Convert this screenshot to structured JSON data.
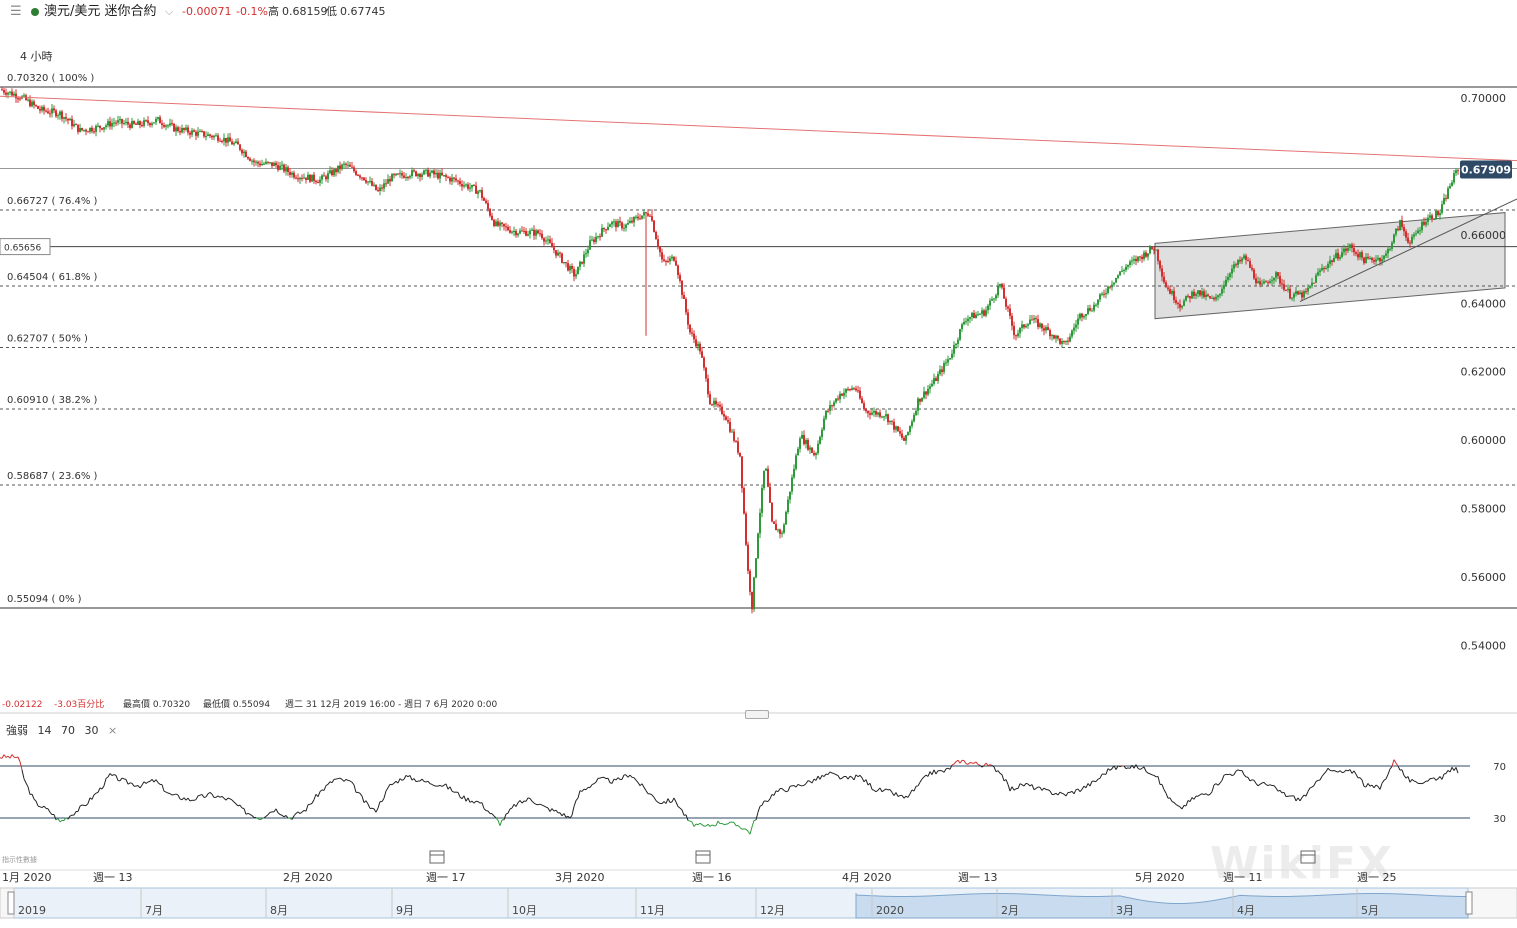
{
  "header": {
    "menu_icon": "hamburger-menu-icon",
    "status_color": "#2e7d32",
    "instrument": "澳元/美元 迷你合約",
    "change": "-0.00071",
    "change_pct": "-0.1%",
    "high_label": "高",
    "high": "0.68159",
    "low_label": "低",
    "low": "0.67745"
  },
  "timeframe": "4 小時",
  "stats": {
    "change": "-0.02122",
    "change_pct": "-3.03百分比",
    "highest": "最高價 0.70320",
    "lowest": "最低價 0.55094",
    "range": "週二 31 12月 2019 16:00 - 週日 7 6月 2020 0:00"
  },
  "rsi_legend": {
    "name": "強弱",
    "period": "14",
    "upper": "70",
    "lower": "30",
    "close": "×"
  },
  "indicator_data_label": "指示性數據",
  "watermark": "WikiFX",
  "colors": {
    "up": "#2e9a3a",
    "down": "#d32f2f",
    "trendline": "#e57373",
    "current_price_bg": "#2f4a66",
    "channel_fill": "#d9d9d9",
    "navigator_fill": "#c9dcef"
  },
  "chart_data": [
    {
      "type": "candlestick",
      "y_range": [
        0.535,
        0.704
      ],
      "y_ticks": [
        "0.70000",
        "0.66000",
        "0.64000",
        "0.62000",
        "0.60000",
        "0.58000",
        "0.56000",
        "0.54000"
      ],
      "current_price": "0.67909",
      "cursor_price": "0.65656",
      "fib_levels": [
        {
          "label": "0.70320 ( 100% )",
          "value": 0.7032
        },
        {
          "label": "0.66727 ( 76.4% )",
          "value": 0.66727
        },
        {
          "label": "0.64504 ( 61.8% )",
          "value": 0.64504
        },
        {
          "label": "0.62707 ( 50% )",
          "value": 0.62707
        },
        {
          "label": "0.60910 ( 38.2% )",
          "value": 0.6091
        },
        {
          "label": "0.58687 ( 23.6% )",
          "value": 0.58687
        },
        {
          "label": "0.55094 ( 0% )",
          "value": 0.55094
        }
      ],
      "series_close": [
        [
          0,
          0.7025
        ],
        [
          20,
          0.7005
        ],
        [
          40,
          0.6965
        ],
        [
          60,
          0.6955
        ],
        [
          80,
          0.6905
        ],
        [
          100,
          0.6915
        ],
        [
          115,
          0.693
        ],
        [
          135,
          0.692
        ],
        [
          158,
          0.6935
        ],
        [
          175,
          0.691
        ],
        [
          200,
          0.6895
        ],
        [
          220,
          0.6885
        ],
        [
          238,
          0.686
        ],
        [
          255,
          0.681
        ],
        [
          275,
          0.6805
        ],
        [
          295,
          0.6775
        ],
        [
          320,
          0.676
        ],
        [
          345,
          0.6805
        ],
        [
          365,
          0.6765
        ],
        [
          378,
          0.6725
        ],
        [
          390,
          0.6765
        ],
        [
          410,
          0.678
        ],
        [
          430,
          0.678
        ],
        [
          455,
          0.676
        ],
        [
          480,
          0.6725
        ],
        [
          495,
          0.663
        ],
        [
          515,
          0.661
        ],
        [
          540,
          0.6605
        ],
        [
          560,
          0.6535
        ],
        [
          575,
          0.648
        ],
        [
          590,
          0.6575
        ],
        [
          610,
          0.6635
        ],
        [
          625,
          0.6625
        ],
        [
          640,
          0.6655
        ],
        [
          650,
          0.6665
        ],
        [
          655,
          0.6605
        ],
        [
          663,
          0.6515
        ],
        [
          675,
          0.6535
        ],
        [
          690,
          0.6315
        ],
        [
          700,
          0.6265
        ],
        [
          710,
          0.6115
        ],
        [
          725,
          0.6075
        ],
        [
          740,
          0.5955
        ],
        [
          748,
          0.5615
        ],
        [
          752,
          0.5515
        ],
        [
          758,
          0.5735
        ],
        [
          765,
          0.5935
        ],
        [
          772,
          0.5755
        ],
        [
          782,
          0.5725
        ],
        [
          790,
          0.5855
        ],
        [
          800,
          0.6015
        ],
        [
          815,
          0.5955
        ],
        [
          825,
          0.6075
        ],
        [
          840,
          0.6135
        ],
        [
          855,
          0.6155
        ],
        [
          865,
          0.6085
        ],
        [
          885,
          0.6075
        ],
        [
          905,
          0.5995
        ],
        [
          918,
          0.6115
        ],
        [
          935,
          0.6175
        ],
        [
          950,
          0.6245
        ],
        [
          965,
          0.6355
        ],
        [
          985,
          0.6375
        ],
        [
          1000,
          0.6455
        ],
        [
          1015,
          0.6305
        ],
        [
          1030,
          0.6355
        ],
        [
          1050,
          0.6315
        ],
        [
          1065,
          0.6275
        ],
        [
          1080,
          0.6365
        ],
        [
          1095,
          0.6395
        ],
        [
          1110,
          0.6455
        ],
        [
          1125,
          0.6505
        ],
        [
          1140,
          0.6535
        ],
        [
          1155,
          0.6565
        ],
        [
          1165,
          0.6455
        ],
        [
          1180,
          0.6395
        ],
        [
          1195,
          0.6435
        ],
        [
          1215,
          0.6405
        ],
        [
          1230,
          0.6495
        ],
        [
          1245,
          0.6535
        ],
        [
          1260,
          0.6445
        ],
        [
          1275,
          0.6485
        ],
        [
          1290,
          0.6425
        ],
        [
          1305,
          0.6425
        ],
        [
          1320,
          0.6495
        ],
        [
          1335,
          0.6535
        ],
        [
          1350,
          0.6565
        ],
        [
          1365,
          0.6525
        ],
        [
          1385,
          0.6535
        ],
        [
          1400,
          0.6635
        ],
        [
          1410,
          0.6575
        ],
        [
          1425,
          0.6645
        ],
        [
          1440,
          0.6665
        ],
        [
          1450,
          0.6745
        ],
        [
          1458,
          0.6795
        ]
      ],
      "extreme_wicks": [
        [
          646,
          0.6305
        ],
        [
          652,
          0.6675
        ],
        [
          752,
          0.5509
        ]
      ],
      "trendline": {
        "from": [
          0,
          0.7005
        ],
        "to": [
          1517,
          0.6817
        ]
      },
      "channel": {
        "upper": [
          [
            1155,
            0.6575
          ],
          [
            1505,
            0.6665
          ]
        ],
        "lower": [
          [
            1155,
            0.6355
          ],
          [
            1505,
            0.6445
          ]
        ]
      },
      "support_line": {
        "from": [
          1300,
          0.6405
        ],
        "to": [
          1517,
          0.6705
        ]
      }
    },
    {
      "type": "line",
      "name": "強弱",
      "y_range": [
        0,
        100
      ],
      "levels": [
        {
          "label": "70",
          "value": 70
        },
        {
          "label": "30",
          "value": 30
        }
      ],
      "values": [
        [
          0,
          77
        ],
        [
          18,
          77
        ],
        [
          25,
          58
        ],
        [
          35,
          42
        ],
        [
          50,
          35
        ],
        [
          60,
          27
        ],
        [
          72,
          33
        ],
        [
          85,
          40
        ],
        [
          100,
          52
        ],
        [
          110,
          63
        ],
        [
          125,
          58
        ],
        [
          140,
          55
        ],
        [
          155,
          59
        ],
        [
          170,
          48
        ],
        [
          190,
          44
        ],
        [
          210,
          48
        ],
        [
          230,
          44
        ],
        [
          245,
          35
        ],
        [
          260,
          30
        ],
        [
          275,
          37
        ],
        [
          290,
          30
        ],
        [
          305,
          36
        ],
        [
          320,
          50
        ],
        [
          335,
          60
        ],
        [
          350,
          58
        ],
        [
          365,
          42
        ],
        [
          375,
          35
        ],
        [
          390,
          55
        ],
        [
          405,
          62
        ],
        [
          425,
          58
        ],
        [
          445,
          55
        ],
        [
          465,
          45
        ],
        [
          480,
          42
        ],
        [
          500,
          26
        ],
        [
          515,
          40
        ],
        [
          530,
          45
        ],
        [
          545,
          38
        ],
        [
          560,
          34
        ],
        [
          570,
          30
        ],
        [
          580,
          50
        ],
        [
          600,
          60
        ],
        [
          615,
          58
        ],
        [
          630,
          64
        ],
        [
          645,
          52
        ],
        [
          660,
          42
        ],
        [
          675,
          44
        ],
        [
          690,
          26
        ],
        [
          705,
          23
        ],
        [
          720,
          27
        ],
        [
          740,
          24
        ],
        [
          750,
          19
        ],
        [
          760,
          38
        ],
        [
          775,
          50
        ],
        [
          790,
          53
        ],
        [
          810,
          58
        ],
        [
          830,
          64
        ],
        [
          845,
          60
        ],
        [
          860,
          62
        ],
        [
          875,
          52
        ],
        [
          890,
          50
        ],
        [
          905,
          45
        ],
        [
          915,
          52
        ],
        [
          930,
          65
        ],
        [
          945,
          66
        ],
        [
          960,
          74
        ],
        [
          975,
          72
        ],
        [
          990,
          70
        ],
        [
          1000,
          66
        ],
        [
          1010,
          52
        ],
        [
          1025,
          56
        ],
        [
          1040,
          52
        ],
        [
          1050,
          50
        ],
        [
          1065,
          48
        ],
        [
          1080,
          52
        ],
        [
          1095,
          58
        ],
        [
          1110,
          68
        ],
        [
          1125,
          70
        ],
        [
          1140,
          69
        ],
        [
          1155,
          64
        ],
        [
          1170,
          44
        ],
        [
          1180,
          37
        ],
        [
          1195,
          46
        ],
        [
          1210,
          50
        ],
        [
          1225,
          63
        ],
        [
          1240,
          66
        ],
        [
          1255,
          57
        ],
        [
          1270,
          55
        ],
        [
          1285,
          48
        ],
        [
          1300,
          44
        ],
        [
          1315,
          55
        ],
        [
          1325,
          67
        ],
        [
          1340,
          65
        ],
        [
          1355,
          66
        ],
        [
          1365,
          55
        ],
        [
          1380,
          53
        ],
        [
          1395,
          75
        ],
        [
          1405,
          62
        ],
        [
          1415,
          56
        ],
        [
          1430,
          60
        ],
        [
          1445,
          62
        ],
        [
          1452,
          69
        ],
        [
          1458,
          66
        ]
      ]
    }
  ],
  "time_axis": [
    {
      "label": "1月 2020",
      "calendar": false
    },
    {
      "label": "週一 13",
      "calendar": false
    },
    {
      "label": "2月 2020",
      "calendar": false
    },
    {
      "label": "週一 17",
      "calendar": true
    },
    {
      "label": "3月 2020",
      "calendar": false
    },
    {
      "label": "週一 16",
      "calendar": true
    },
    {
      "label": "4月 2020",
      "calendar": false
    },
    {
      "label": "週一 13",
      "calendar": false
    },
    {
      "label": "5月 2020",
      "calendar": false
    },
    {
      "label": "週一 11",
      "calendar": false
    },
    {
      "label": "週一 25",
      "calendar": true
    }
  ],
  "navigator": {
    "labels": [
      "2019",
      "7月",
      "8月",
      "9月",
      "10月",
      "11月",
      "12月",
      "2020",
      "2月",
      "3月",
      "4月",
      "5月"
    ]
  }
}
